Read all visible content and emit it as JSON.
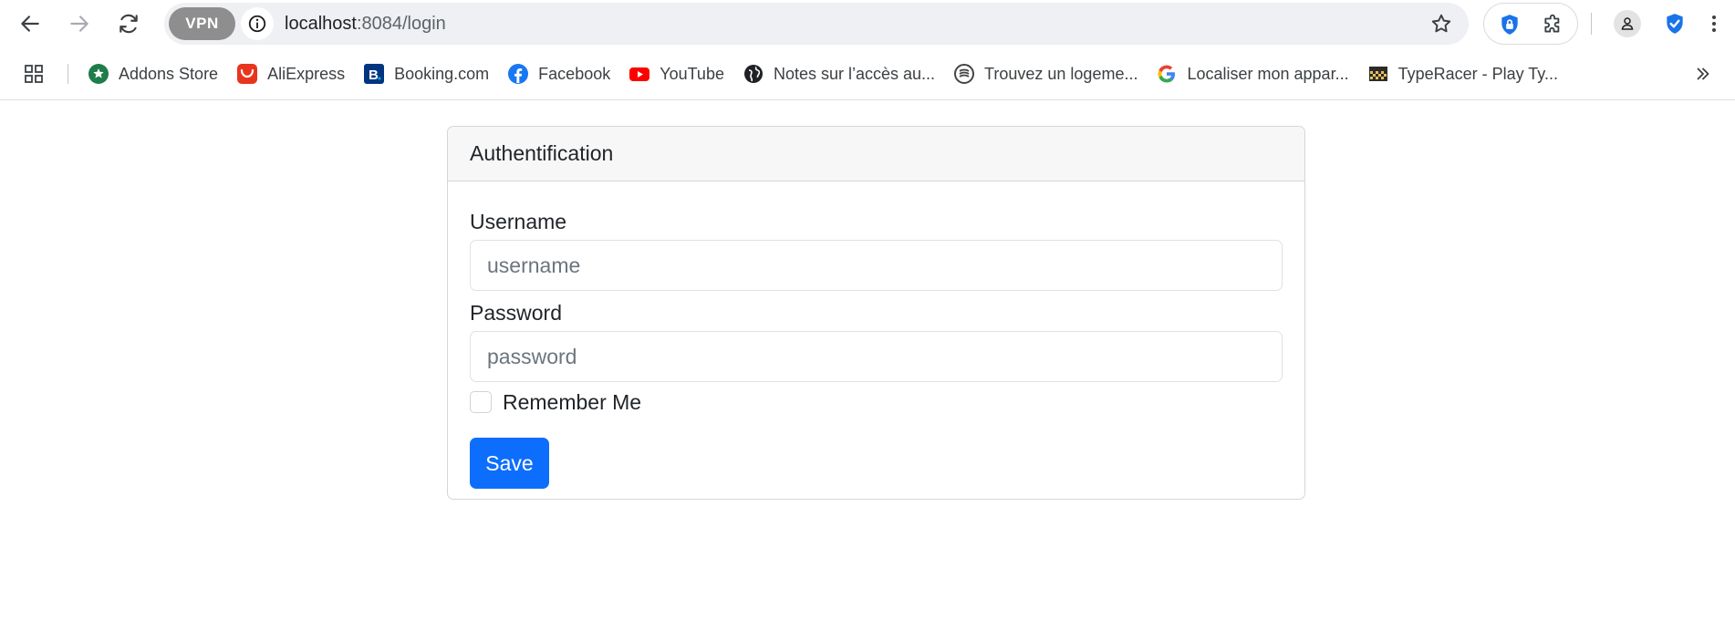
{
  "browser": {
    "vpn_label": "VPN",
    "url_host": "localhost",
    "url_path": ":8084/login",
    "icons": {
      "back": "back-arrow-icon",
      "forward": "forward-arrow-icon",
      "reload": "reload-icon",
      "info": "info-icon",
      "star": "star-icon",
      "password_manager": "lock-shield-icon",
      "extensions": "puzzle-icon",
      "profile": "profile-icon",
      "security": "check-shield-icon",
      "menu": "kebab-menu-icon"
    }
  },
  "bookmarks": [
    {
      "label": "Addons Store",
      "icon": "addons-store-icon",
      "color": "#1e7d4a"
    },
    {
      "label": "AliExpress",
      "icon": "aliexpress-icon",
      "color": "#e8351d"
    },
    {
      "label": "Booking.com",
      "icon": "booking-icon",
      "color": "#003580"
    },
    {
      "label": "Facebook",
      "icon": "facebook-icon",
      "color": "#1877f2"
    },
    {
      "label": "YouTube",
      "icon": "youtube-icon",
      "color": "#ff0000"
    },
    {
      "label": "Notes sur l’accès au...",
      "icon": "globe-icon",
      "color": "#202124"
    },
    {
      "label": "Trouvez un logeme...",
      "icon": "logement-icon",
      "color": "#444444"
    },
    {
      "label": "Localiser mon appar...",
      "icon": "google-icon",
      "color": "#4285f4"
    },
    {
      "label": "TypeRacer - Play Ty...",
      "icon": "typeracer-icon",
      "color": "#b58b2c"
    }
  ],
  "form": {
    "title": "Authentification",
    "username_label": "Username",
    "username_placeholder": "username",
    "username_value": "",
    "password_label": "Password",
    "password_placeholder": "password",
    "password_value": "",
    "remember_label": "Remember Me",
    "remember_checked": false,
    "save_label": "Save",
    "accent": "#0d6efd"
  }
}
